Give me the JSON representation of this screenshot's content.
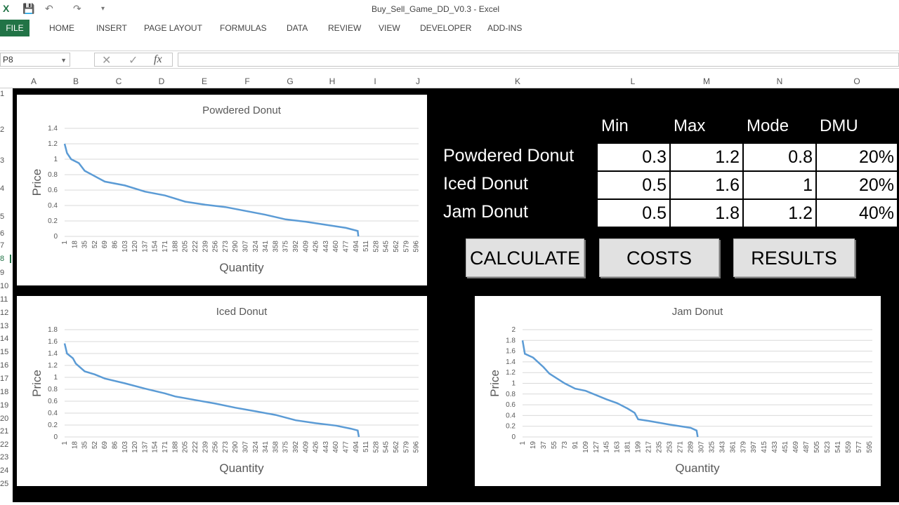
{
  "app": {
    "title": "Buy_Sell_Game_DD_V0.3 - Excel",
    "tabs": [
      "FILE",
      "HOME",
      "INSERT",
      "PAGE LAYOUT",
      "FORMULAS",
      "DATA",
      "REVIEW",
      "VIEW",
      "DEVELOPER",
      "ADD-INS"
    ],
    "name_box": "P8",
    "formula": "",
    "icons": [
      "excel-icon",
      "save-icon",
      "undo-icon",
      "redo-icon",
      "customize-icon",
      "cancel-icon",
      "enter-icon",
      "fx-icon"
    ]
  },
  "columns": [
    "A",
    "B",
    "C",
    "D",
    "E",
    "F",
    "G",
    "H",
    "I",
    "J",
    "K",
    "L",
    "M",
    "N",
    "O"
  ],
  "rows": [
    "1",
    "2",
    "3",
    "4",
    "5",
    "6",
    "7",
    "8",
    "9",
    "10",
    "11",
    "12",
    "13",
    "14",
    "15",
    "16",
    "17",
    "18",
    "19",
    "20",
    "21",
    "22",
    "23",
    "24",
    "25"
  ],
  "selected_row": "8",
  "table": {
    "headers": [
      "Min",
      "Max",
      "Mode",
      "DMU"
    ],
    "rows": [
      {
        "label": "Powdered Donut",
        "values": [
          "0.3",
          "1.2",
          "0.8",
          "20%"
        ]
      },
      {
        "label": "Iced Donut",
        "values": [
          "0.5",
          "1.6",
          "1",
          "20%"
        ]
      },
      {
        "label": "Jam Donut",
        "values": [
          "0.5",
          "1.8",
          "1.2",
          "40%"
        ]
      }
    ]
  },
  "buttons": {
    "calculate": "CALCULATE",
    "costs": "COSTS",
    "results": "RESULTS"
  },
  "chart_data": [
    {
      "type": "line",
      "title": "Powdered Donut",
      "xlabel": "Quantity",
      "ylabel": "Price",
      "ylim": [
        0,
        1.4
      ],
      "yticks": [
        "0",
        "0.2",
        "0.4",
        "0.6",
        "0.8",
        "1",
        "1.2",
        "1.4"
      ],
      "xlim": [
        1,
        600
      ],
      "xtick_start": 1,
      "xtick_step": 17,
      "xtick_end": 596,
      "grid": true,
      "color": "#5b9bd5",
      "x": [
        1,
        5,
        12,
        25,
        35,
        52,
        69,
        103,
        137,
        171,
        205,
        239,
        273,
        307,
        341,
        375,
        409,
        443,
        477,
        497,
        498
      ],
      "y": [
        1.2,
        1.08,
        1.0,
        0.95,
        0.85,
        0.78,
        0.71,
        0.66,
        0.58,
        0.53,
        0.45,
        0.41,
        0.38,
        0.33,
        0.28,
        0.22,
        0.19,
        0.15,
        0.11,
        0.07,
        0
      ]
    },
    {
      "type": "line",
      "title": "Iced Donut",
      "xlabel": "Quantity",
      "ylabel": "Price",
      "ylim": [
        0,
        1.8
      ],
      "yticks": [
        "0",
        "0.2",
        "0.4",
        "0.6",
        "0.8",
        "1",
        "1.2",
        "1.4",
        "1.6",
        "1.8"
      ],
      "xlim": [
        1,
        600
      ],
      "xtick_start": 1,
      "xtick_step": 17,
      "xtick_end": 596,
      "grid": true,
      "color": "#5b9bd5",
      "x": [
        1,
        5,
        15,
        20,
        35,
        52,
        69,
        103,
        137,
        171,
        188,
        222,
        256,
        290,
        324,
        358,
        392,
        426,
        460,
        485,
        497,
        499
      ],
      "y": [
        1.57,
        1.4,
        1.32,
        1.23,
        1.1,
        1.05,
        0.98,
        0.9,
        0.81,
        0.73,
        0.68,
        0.62,
        0.56,
        0.49,
        0.43,
        0.37,
        0.28,
        0.23,
        0.19,
        0.14,
        0.11,
        0
      ]
    },
    {
      "type": "line",
      "title": "Jam Donut",
      "xlabel": "Quantity",
      "ylabel": "Price",
      "ylim": [
        0,
        2
      ],
      "yticks": [
        "0",
        "0.2",
        "0.4",
        "0.6",
        "0.8",
        "1",
        "1.2",
        "1.4",
        "1.6",
        "1.8",
        "2"
      ],
      "xlim": [
        1,
        600
      ],
      "xtick_start": 1,
      "xtick_step": 18,
      "xtick_end": 595,
      "grid": true,
      "color": "#5b9bd5",
      "x": [
        1,
        5,
        19,
        37,
        47,
        73,
        91,
        109,
        145,
        163,
        181,
        193,
        199,
        217,
        253,
        289,
        299,
        301
      ],
      "y": [
        1.8,
        1.55,
        1.48,
        1.3,
        1.18,
        1.0,
        0.9,
        0.86,
        0.7,
        0.63,
        0.53,
        0.45,
        0.33,
        0.3,
        0.23,
        0.17,
        0.12,
        0
      ]
    }
  ]
}
